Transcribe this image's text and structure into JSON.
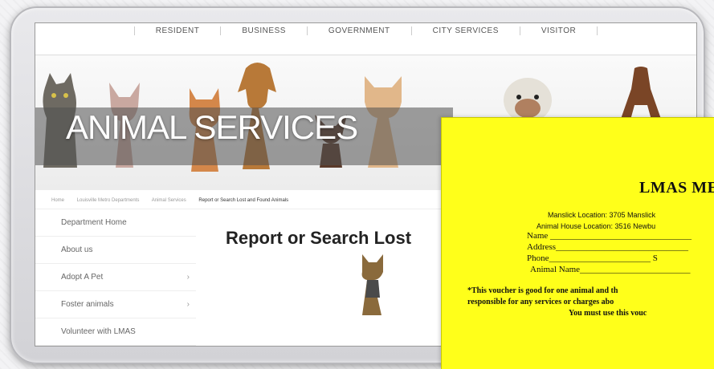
{
  "topnav": {
    "items": [
      "RESIDENT",
      "BUSINESS",
      "GOVERNMENT",
      "CITY SERVICES",
      "VISITOR"
    ]
  },
  "hero": {
    "title": "ANIMAL SERVICES"
  },
  "breadcrumb": {
    "items": [
      "Home",
      "Louisville Metro Departments",
      "Animal Services",
      "Report or Search Lost and Found Animals"
    ]
  },
  "sidebar": {
    "items": [
      {
        "label": "Department Home",
        "chevron": ""
      },
      {
        "label": "About us",
        "chevron": ""
      },
      {
        "label": "Adopt A Pet",
        "chevron": "›"
      },
      {
        "label": "Foster animals",
        "chevron": "›"
      },
      {
        "label": "Volunteer with LMAS",
        "chevron": ""
      }
    ]
  },
  "main": {
    "title": "Report or Search Lost"
  },
  "voucher": {
    "title": "LMAS ME",
    "loc1": "Manslick Location: 3705 Manslick",
    "loc2": "Animal House Location: 3516 Newbu",
    "field_name": "Name ________________________________",
    "field_address": "Address______________________________",
    "field_phone": "Phone_______________________ S",
    "field_animal": "Animal  Name_________________________",
    "note1": "*This voucher is good for one animal and th",
    "note2": "responsible for any services or charges abo",
    "note3": "You must use this vouc"
  }
}
